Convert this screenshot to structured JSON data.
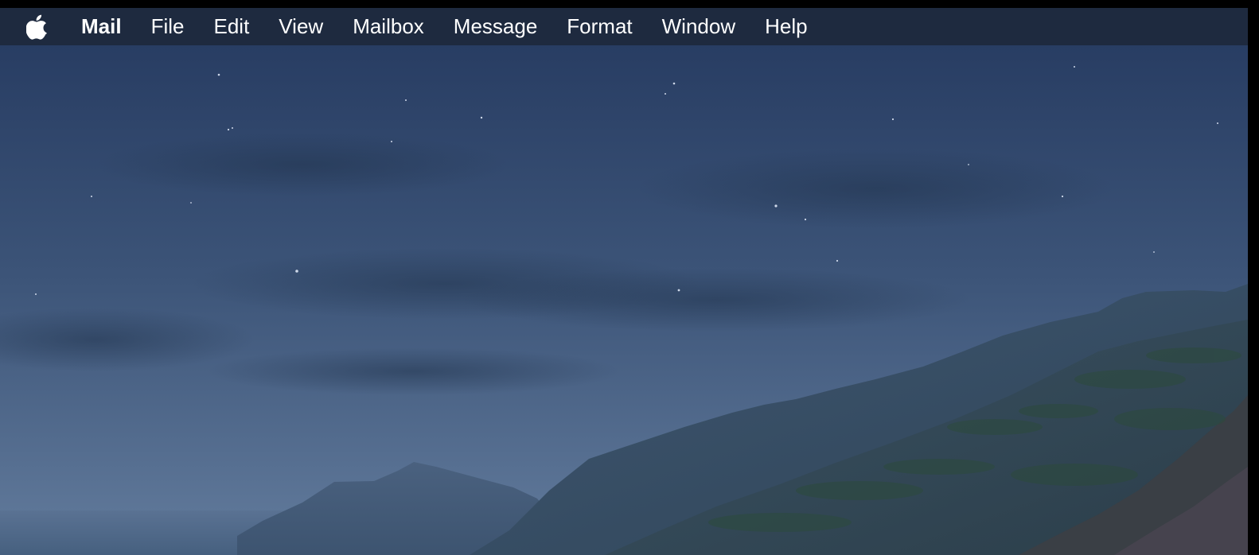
{
  "menubar": {
    "apple_icon": "apple-logo-icon",
    "app_name": "Mail",
    "items": [
      {
        "label": "File"
      },
      {
        "label": "Edit"
      },
      {
        "label": "View"
      },
      {
        "label": "Mailbox"
      },
      {
        "label": "Message"
      },
      {
        "label": "Format"
      },
      {
        "label": "Window"
      },
      {
        "label": "Help"
      }
    ]
  },
  "desktop": {
    "wallpaper": "night-coastal-mountains"
  },
  "colors": {
    "menubar_bg": "#1e2a3f",
    "menubar_text": "#ffffff",
    "sky_top": "#2a3f66",
    "sky_bottom": "#5c7598",
    "hills": "#31485f"
  }
}
